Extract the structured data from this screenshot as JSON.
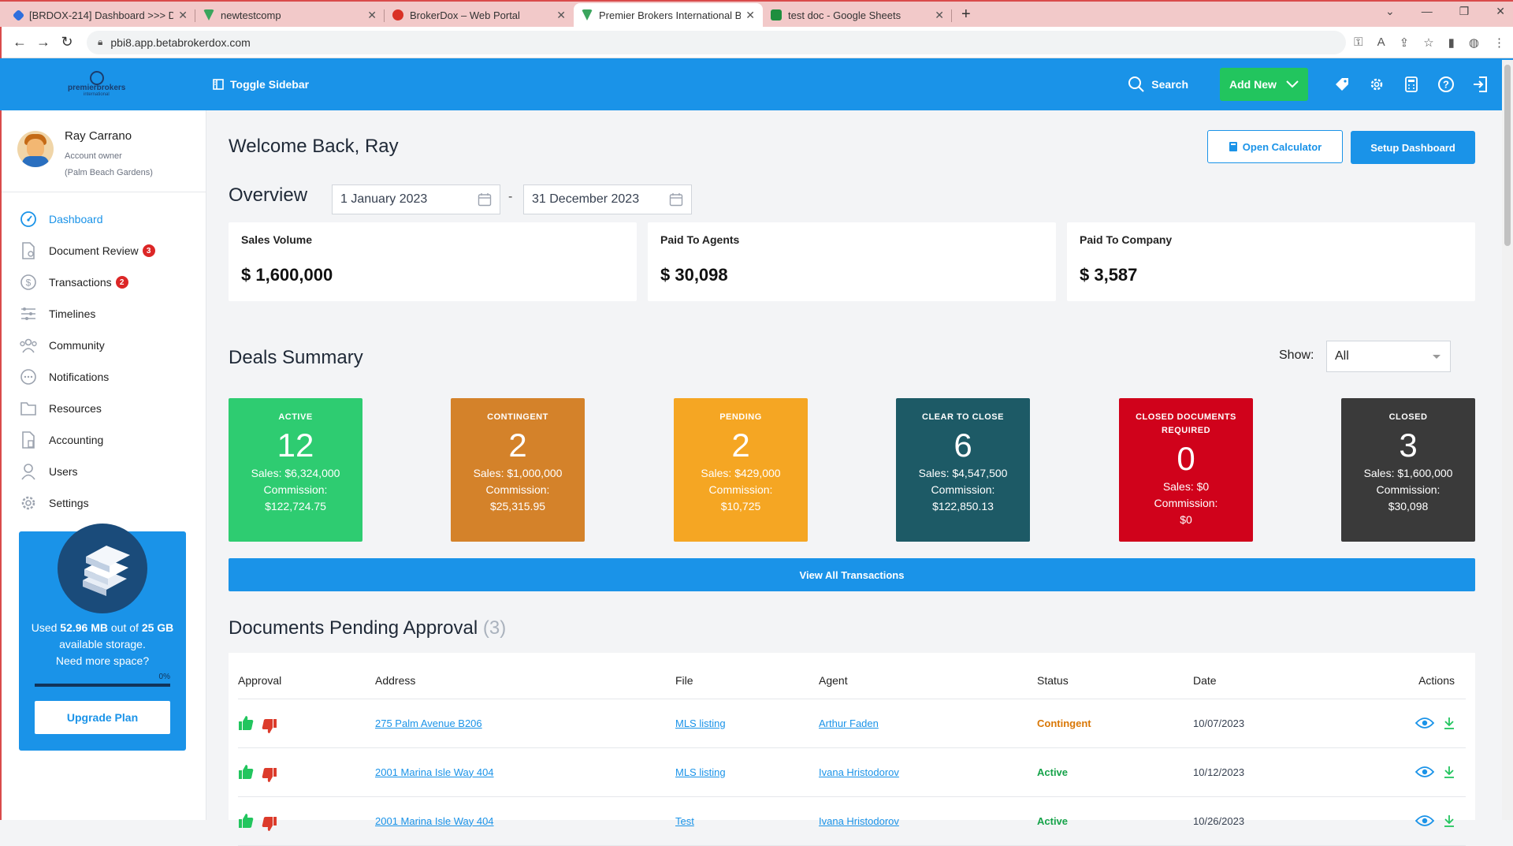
{
  "browser": {
    "tabs": [
      {
        "title": "[BRDOX-214] Dashboard >>> D",
        "favicon_color": "#2f6fdd"
      },
      {
        "title": "newtestcomp",
        "favicon_color": "#3aa55d"
      },
      {
        "title": "BrokerDox – Web Portal",
        "favicon_color": "#d93025"
      },
      {
        "title": "Premier Brokers International Br",
        "favicon_color": "#3aa55d",
        "active": true
      },
      {
        "title": "test doc - Google Sheets",
        "favicon_color": "#1e8e3e"
      }
    ],
    "new_tab": "+",
    "url": "pbi8.app.betabrokerdox.com"
  },
  "header": {
    "logo_text": "premierbrokers",
    "logo_sub": "international",
    "toggle_sidebar": "Toggle Sidebar",
    "search": "Search",
    "add_new": "Add New"
  },
  "user": {
    "name": "Ray Carrano",
    "role": "Account owner",
    "office": "(Palm Beach Gardens)"
  },
  "sidebar": {
    "items": [
      {
        "label": "Dashboard",
        "icon": "gauge-icon",
        "active": true
      },
      {
        "label": "Document Review",
        "icon": "document-icon",
        "badge": "3"
      },
      {
        "label": "Transactions",
        "icon": "dollar-icon",
        "badge": "2"
      },
      {
        "label": "Timelines",
        "icon": "timeline-icon"
      },
      {
        "label": "Community",
        "icon": "community-icon"
      },
      {
        "label": "Notifications",
        "icon": "chat-icon"
      },
      {
        "label": "Resources",
        "icon": "folder-icon"
      },
      {
        "label": "Accounting",
        "icon": "accounting-icon"
      },
      {
        "label": "Users",
        "icon": "user-icon"
      },
      {
        "label": "Settings",
        "icon": "gear-icon"
      }
    ],
    "storage": {
      "used": "52.96 MB",
      "total": "25 GB",
      "line1_pre": "Used ",
      "line1_mid": " out of ",
      "line2": " available storage.",
      "line3": "Need more space?",
      "percent": "0%",
      "upgrade": "Upgrade Plan"
    }
  },
  "main": {
    "welcome": "Welcome Back, Ray",
    "open_calculator": "Open Calculator",
    "setup_dashboard": "Setup Dashboard",
    "overview": "Overview",
    "date_from": "1 January 2023",
    "date_separator": "-",
    "date_to": "31 December 2023",
    "stats": [
      {
        "label": "Sales Volume",
        "value": "$ 1,600,000"
      },
      {
        "label": "Paid To Agents",
        "value": "$ 30,098"
      },
      {
        "label": "Paid To Company",
        "value": "$ 3,587"
      }
    ],
    "deals_title": "Deals Summary",
    "show_label": "Show:",
    "show_value": "All",
    "deals": [
      {
        "title": "ACTIVE",
        "count": "12",
        "sales": "Sales: $6,324,000",
        "commission_label": "Commission:",
        "commission": "$122,724.75",
        "color": "#2ecc71"
      },
      {
        "title": "CONTINGENT",
        "count": "2",
        "sales": "Sales: $1,000,000",
        "commission_label": "Commission:",
        "commission": "$25,315.95",
        "color": "#d4822a"
      },
      {
        "title": "PENDING",
        "count": "2",
        "sales": "Sales: $429,000",
        "commission_label": "Commission:",
        "commission": "$10,725",
        "color": "#f5a623"
      },
      {
        "title": "CLEAR TO CLOSE",
        "count": "6",
        "sales": "Sales: $4,547,500",
        "commission_label": "Commission:",
        "commission": "$122,850.13",
        "color": "#1d5a66"
      },
      {
        "title": "CLOSED DOCUMENTS REQUIRED",
        "count": "0",
        "sales": "Sales: $0",
        "commission_label": "Commission:",
        "commission": "$0",
        "color": "#d0021b"
      },
      {
        "title": "CLOSED",
        "count": "3",
        "sales": "Sales: $1,600,000",
        "commission_label": "Commission:",
        "commission": "$30,098",
        "color": "#3a3a3a"
      }
    ],
    "view_all": "View All Transactions",
    "docs_title": "Documents Pending Approval",
    "docs_count": "(3)",
    "table": {
      "headers": [
        "Approval",
        "Address",
        "File",
        "Agent",
        "Status",
        "Date",
        "Actions"
      ],
      "rows": [
        {
          "address": "275 Palm Avenue B206",
          "file": "MLS listing",
          "agent": "Arthur Faden",
          "status": "Contingent",
          "date": "10/07/2023"
        },
        {
          "address": "2001 Marina Isle Way 404",
          "file": "MLS listing",
          "agent": "Ivana Hristodorov",
          "status": "Active",
          "date": "10/12/2023"
        },
        {
          "address": "2001 Marina Isle Way 404",
          "file": "Test",
          "agent": "Ivana Hristodorov",
          "status": "Active",
          "date": "10/26/2023"
        }
      ]
    }
  },
  "colors": {
    "primary": "#1a93e8",
    "success": "#22c55e"
  }
}
